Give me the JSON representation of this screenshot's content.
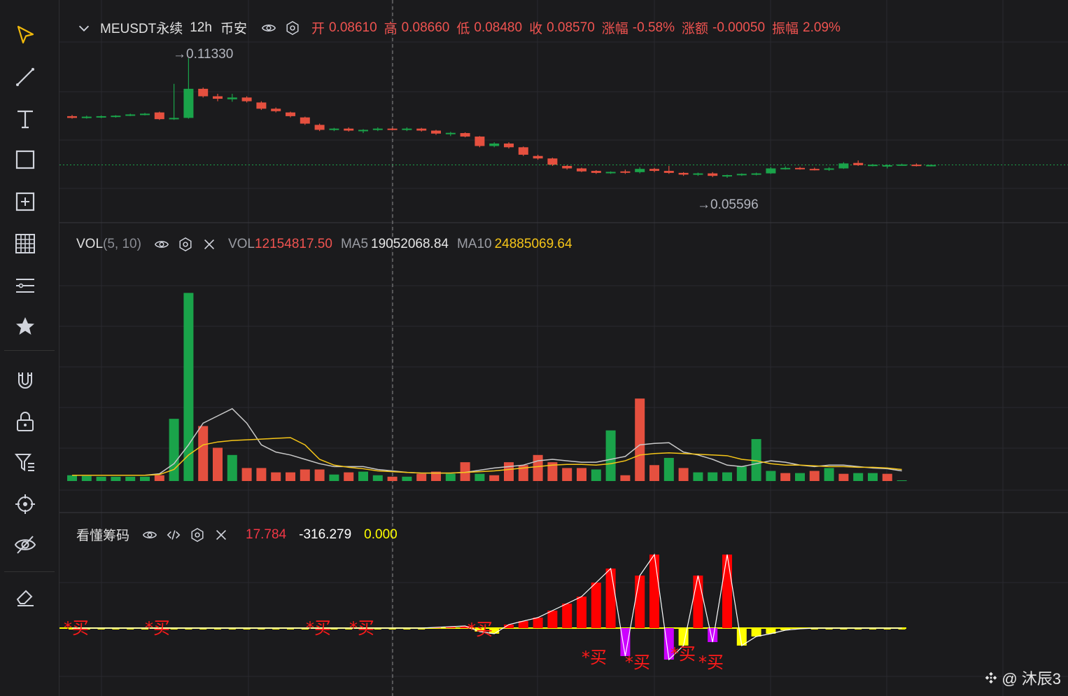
{
  "toolbar": {
    "items": [
      {
        "icon": "cursor-arrow-icon"
      },
      {
        "icon": "trend-line-icon"
      },
      {
        "icon": "text-tool-icon"
      },
      {
        "icon": "rectangle-tool-icon"
      },
      {
        "icon": "measure-tool-icon"
      },
      {
        "icon": "grid-pattern-icon"
      },
      {
        "icon": "fib-lines-icon"
      },
      {
        "icon": "favorite-star-icon"
      },
      {
        "icon": "magnet-icon"
      },
      {
        "icon": "lock-icon"
      },
      {
        "icon": "indicator-filter-icon"
      },
      {
        "icon": "target-icon"
      },
      {
        "icon": "hide-eye-icon"
      },
      {
        "icon": "eraser-icon"
      }
    ],
    "accent": "#f0b90b"
  },
  "main_legend": {
    "symbol": "MEUSDT永续",
    "interval": "12h",
    "exchange": "币安",
    "open_label": "开",
    "open": "0.08610",
    "high_label": "高",
    "high": "0.08660",
    "low_label": "低",
    "low": "0.08480",
    "close_label": "收",
    "close": "0.08570",
    "change_pct_label": "涨幅",
    "change_pct": "-0.58%",
    "change_amt_label": "涨额",
    "change_amt": "-0.00050",
    "amplitude_label": "振幅",
    "amplitude": "2.09%"
  },
  "price_markers": {
    "high": "→0.11330",
    "low": "→0.05596"
  },
  "vol_legend": {
    "name": "VOL",
    "params": "(5, 10)",
    "vol_label": "VOL",
    "vol": "12154817.50",
    "ma5_label": "MA5",
    "ma5": "19052068.84",
    "ma10_label": "MA10",
    "ma10": "24885069.64"
  },
  "ind_legend": {
    "name": "看懂筹码",
    "v1": "17.784",
    "v2": "-316.279",
    "v3": "0.000"
  },
  "buy_label": "*买",
  "watermark": "@ 沐辰3",
  "colors": {
    "up": "#0ecb81",
    "down": "#f6465d",
    "candle_up": "#1aa34a",
    "candle_down": "#e5503f",
    "ma5": "#c9c9c9",
    "ma10": "#f5c518",
    "ind_red": "#ff0000",
    "ind_magenta": "#cc00ff",
    "ind_yellow": "#ffff00"
  },
  "chart_data": [
    {
      "type": "candlestick",
      "title": "MEUSDT永续 12h 币安",
      "ylim": [
        0.05,
        0.117
      ],
      "annotations": [
        "→0.11330",
        "→0.05596"
      ],
      "ohlc": [
        [
          0.09,
          0.0905,
          0.089,
          0.0893
        ],
        [
          0.0895,
          0.0902,
          0.089,
          0.0898
        ],
        [
          0.0895,
          0.0903,
          0.0892,
          0.09
        ],
        [
          0.0897,
          0.0904,
          0.0894,
          0.0902
        ],
        [
          0.0902,
          0.091,
          0.09,
          0.0907
        ],
        [
          0.0906,
          0.0913,
          0.0903,
          0.091
        ],
        [
          0.0915,
          0.0918,
          0.0885,
          0.0888
        ],
        [
          0.0888,
          0.103,
          0.0885,
          0.0893
        ],
        [
          0.0893,
          0.1133,
          0.089,
          0.101
        ],
        [
          0.101,
          0.1015,
          0.0975,
          0.098
        ],
        [
          0.098,
          0.099,
          0.096,
          0.097
        ],
        [
          0.0968,
          0.099,
          0.0958,
          0.0975
        ],
        [
          0.0975,
          0.098,
          0.0955,
          0.096
        ],
        [
          0.0955,
          0.096,
          0.0925,
          0.093
        ],
        [
          0.093,
          0.0935,
          0.0915,
          0.092
        ],
        [
          0.0915,
          0.0918,
          0.0895,
          0.09
        ],
        [
          0.0895,
          0.0898,
          0.0865,
          0.087
        ],
        [
          0.0865,
          0.087,
          0.084,
          0.0845
        ],
        [
          0.0845,
          0.0853,
          0.084,
          0.085
        ],
        [
          0.085,
          0.0855,
          0.0838,
          0.0842
        ],
        [
          0.0842,
          0.0848,
          0.0832,
          0.0845
        ],
        [
          0.0845,
          0.0855,
          0.084,
          0.085
        ],
        [
          0.085,
          0.0853,
          0.0843,
          0.0845
        ],
        [
          0.0845,
          0.0855,
          0.084,
          0.085
        ],
        [
          0.085,
          0.0853,
          0.0838,
          0.0842
        ],
        [
          0.0842,
          0.0845,
          0.0825,
          0.083
        ],
        [
          0.083,
          0.0837,
          0.082,
          0.0833
        ],
        [
          0.0832,
          0.0835,
          0.0815,
          0.0818
        ],
        [
          0.0818,
          0.082,
          0.0775,
          0.078
        ],
        [
          0.078,
          0.0795,
          0.0775,
          0.079
        ],
        [
          0.079,
          0.0795,
          0.077,
          0.0775
        ],
        [
          0.0775,
          0.0778,
          0.074,
          0.0745
        ],
        [
          0.074,
          0.0745,
          0.0725,
          0.073
        ],
        [
          0.073,
          0.0733,
          0.07,
          0.0705
        ],
        [
          0.07,
          0.0703,
          0.0685,
          0.069
        ],
        [
          0.069,
          0.0693,
          0.0675,
          0.0678
        ],
        [
          0.068,
          0.0683,
          0.0668,
          0.0672
        ],
        [
          0.0672,
          0.0678,
          0.0668,
          0.0676
        ],
        [
          0.0678,
          0.0685,
          0.0668,
          0.0673
        ],
        [
          0.0675,
          0.0695,
          0.067,
          0.0688
        ],
        [
          0.0688,
          0.0692,
          0.0675,
          0.068
        ],
        [
          0.068,
          0.07,
          0.0668,
          0.0672
        ],
        [
          0.0672,
          0.0675,
          0.066,
          0.0665
        ],
        [
          0.0665,
          0.0673,
          0.066,
          0.067
        ],
        [
          0.067,
          0.0675,
          0.0655,
          0.066
        ],
        [
          0.066,
          0.0665,
          0.0652,
          0.0663
        ],
        [
          0.0663,
          0.067,
          0.066,
          0.0668
        ],
        [
          0.0668,
          0.0673,
          0.0662,
          0.067
        ],
        [
          0.067,
          0.0695,
          0.0668,
          0.069
        ],
        [
          0.069,
          0.0698,
          0.0685,
          0.0692
        ],
        [
          0.0692,
          0.0696,
          0.0685,
          0.0688
        ],
        [
          0.0688,
          0.0693,
          0.0682,
          0.0685
        ],
        [
          0.0685,
          0.0695,
          0.068,
          0.069
        ],
        [
          0.069,
          0.0715,
          0.0688,
          0.071
        ],
        [
          0.0712,
          0.0722,
          0.07,
          0.0703
        ],
        [
          0.0703,
          0.0708,
          0.0698,
          0.0705
        ],
        [
          0.07,
          0.0706,
          0.069,
          0.0703
        ],
        [
          0.0704,
          0.0709,
          0.0702,
          0.0706
        ],
        [
          0.0705,
          0.071,
          0.0698,
          0.07
        ],
        [
          0.0702,
          0.0706,
          0.0698,
          0.0704
        ]
      ]
    },
    {
      "type": "bar",
      "title": "VOL(5, 10)",
      "ylim": [
        0,
        135000000
      ],
      "values": [
        4000000,
        3500000,
        3000000,
        3000000,
        3000000,
        3000000,
        4000000,
        43000000,
        130000000,
        38000000,
        23000000,
        18000000,
        9000000,
        9000000,
        6000000,
        6000000,
        8000000,
        8000000,
        4500000,
        6000000,
        6500000,
        4000000,
        3000000,
        3000000,
        5000000,
        6500000,
        5000000,
        13000000,
        5000000,
        4000000,
        13000000,
        11000000,
        18000000,
        13000000,
        9000000,
        9000000,
        8000000,
        35000000,
        4000000,
        57000000,
        11000000,
        16000000,
        9000000,
        6000000,
        6000000,
        6000000,
        10000000,
        29000000,
        7000000,
        5500000,
        5500000,
        7000000,
        9000000,
        5000000,
        5500000,
        5500000,
        5000000,
        500000
      ],
      "up": [
        true,
        true,
        true,
        true,
        true,
        true,
        false,
        true,
        true,
        false,
        false,
        true,
        false,
        false,
        false,
        false,
        false,
        false,
        true,
        false,
        true,
        true,
        false,
        true,
        false,
        false,
        true,
        false,
        true,
        false,
        false,
        false,
        false,
        false,
        false,
        false,
        true,
        true,
        false,
        false,
        false,
        true,
        false,
        true,
        true,
        true,
        true,
        true,
        true,
        false,
        true,
        false,
        true,
        false,
        true,
        true,
        false,
        true
      ],
      "ma5": [
        4000000,
        4000000,
        4000000,
        4000000,
        4000000,
        4000000,
        5000000,
        12000000,
        25000000,
        40000000,
        45000000,
        50000000,
        40000000,
        25000000,
        20000000,
        18000000,
        15000000,
        12000000,
        10000000,
        10000000,
        10000000,
        8000000,
        7000000,
        6000000,
        5500000,
        5500000,
        5500000,
        6000000,
        7500000,
        9000000,
        10000000,
        11000000,
        14000000,
        15000000,
        14000000,
        13000000,
        13000000,
        15000000,
        17000000,
        25000000,
        26000000,
        26500000,
        20000000,
        18000000,
        15000000,
        11000000,
        10000000,
        12000000,
        14000000,
        13000000,
        11000000,
        10000000,
        11000000,
        11000000,
        10000000,
        9000000,
        8500000,
        7000000
      ],
      "ma10": [
        4000000,
        4000000,
        4000000,
        4000000,
        4000000,
        4000000,
        4500000,
        8000000,
        18000000,
        25000000,
        27000000,
        28000000,
        28500000,
        29000000,
        29500000,
        30000000,
        25000000,
        15000000,
        11000000,
        9500000,
        8500000,
        7000000,
        6500000,
        6000000,
        5500000,
        5500000,
        5500000,
        6000000,
        6500000,
        7000000,
        8000000,
        9000000,
        10000000,
        11000000,
        11500000,
        11500000,
        11000000,
        12000000,
        14000000,
        18000000,
        19000000,
        19500000,
        19000000,
        18500000,
        18000000,
        17500000,
        15000000,
        14000000,
        12000000,
        11000000,
        11000000,
        10500000,
        10000000,
        10000000,
        9500000,
        9500000,
        9000000,
        8000000
      ],
      "ma_last_labels": {
        "VOL": "12154817.50",
        "MA5": "19052068.84",
        "MA10": "24885069.64"
      }
    },
    {
      "type": "bar",
      "title": "看懂筹码",
      "ylim": [
        -60,
        120
      ],
      "values": [
        0,
        0,
        0,
        0,
        0,
        0,
        0,
        0,
        0,
        0,
        0,
        0,
        0,
        0,
        0,
        0,
        0,
        0,
        0,
        0,
        0,
        0,
        0,
        0,
        0,
        1,
        2,
        3,
        -5,
        -8,
        5,
        10,
        15,
        25,
        35,
        45,
        65,
        85,
        -40,
        75,
        105,
        -45,
        -25,
        75,
        -20,
        105,
        -25,
        -12,
        -8,
        -3,
        -1,
        0,
        0,
        0,
        0,
        0,
        0,
        0
      ],
      "marks": [
        "*买",
        "*买",
        "*买",
        "*买",
        "*买",
        "*买",
        "*买",
        "*买",
        "*买"
      ],
      "legend_values": [
        "17.784",
        "-316.279",
        "0.000"
      ]
    }
  ]
}
